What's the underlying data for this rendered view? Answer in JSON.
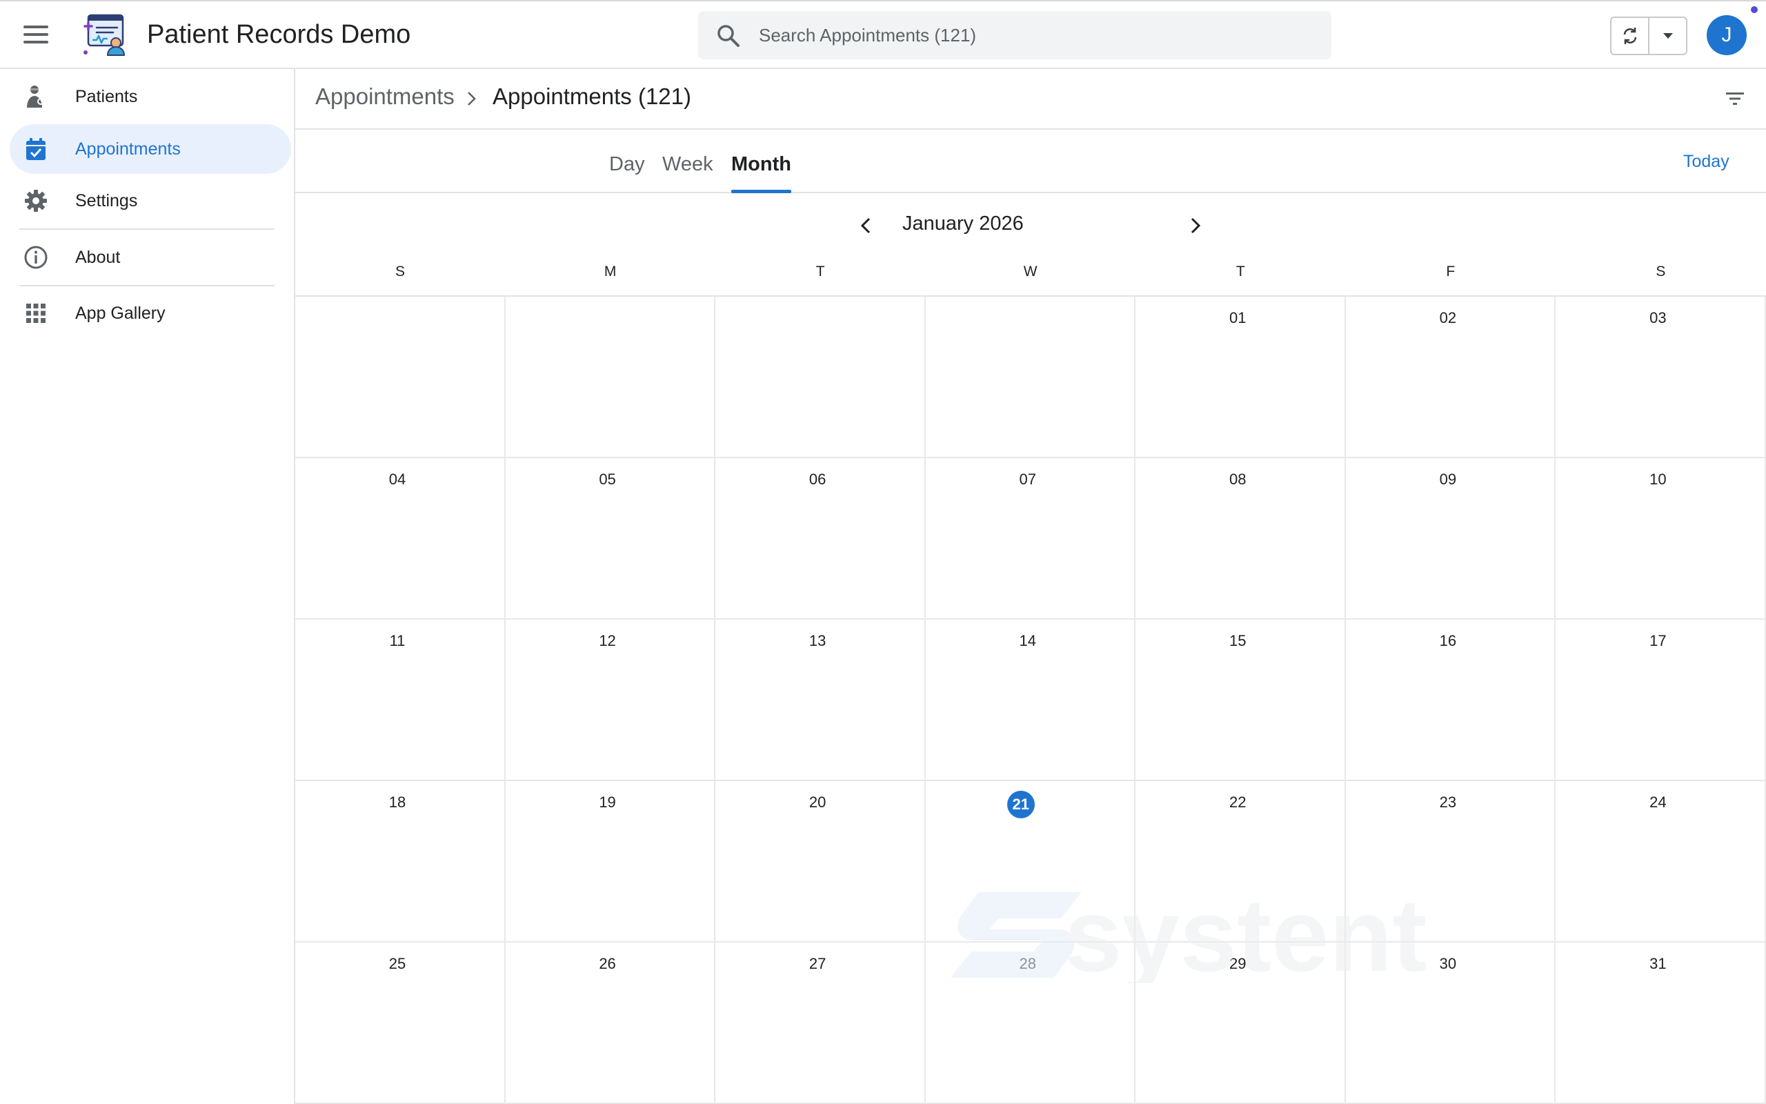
{
  "app": {
    "title": "Patient Records Demo",
    "accent_color": "#1f74cf"
  },
  "search": {
    "placeholder": "Search Appointments (121)"
  },
  "user": {
    "initial": "J"
  },
  "sidebar": {
    "items": [
      {
        "label": "Patients",
        "icon": "patient-icon",
        "active": false
      },
      {
        "label": "Appointments",
        "icon": "calendar-check-icon",
        "active": true
      },
      {
        "label": "Settings",
        "icon": "gear-icon",
        "active": false
      },
      {
        "label": "About",
        "icon": "info-icon",
        "active": false
      },
      {
        "label": "App Gallery",
        "icon": "grid-icon",
        "active": false
      }
    ]
  },
  "breadcrumb": {
    "root": "Appointments",
    "current": "Appointments (121)"
  },
  "views": {
    "tabs": [
      "Day",
      "Week",
      "Month"
    ],
    "active": "Month",
    "today_label": "Today"
  },
  "calendar": {
    "month_label": "January 2026",
    "weekdays": [
      "S",
      "M",
      "T",
      "W",
      "T",
      "F",
      "S"
    ],
    "today": "21",
    "weeks": [
      [
        "",
        "",
        "",
        "",
        "01",
        "02",
        "03"
      ],
      [
        "04",
        "05",
        "06",
        "07",
        "08",
        "09",
        "10"
      ],
      [
        "11",
        "12",
        "13",
        "14",
        "15",
        "16",
        "17"
      ],
      [
        "18",
        "19",
        "20",
        "21",
        "22",
        "23",
        "24"
      ],
      [
        "25",
        "26",
        "27",
        "28",
        "29",
        "30",
        "31"
      ]
    ]
  },
  "watermark": {
    "text": "systent"
  }
}
